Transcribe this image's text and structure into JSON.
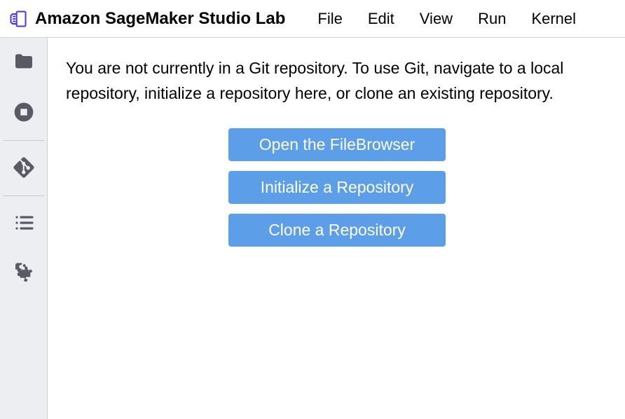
{
  "app": {
    "title": "Amazon SageMaker Studio Lab"
  },
  "menu": {
    "items": [
      {
        "label": "File"
      },
      {
        "label": "Edit"
      },
      {
        "label": "View"
      },
      {
        "label": "Run"
      },
      {
        "label": "Kernel"
      }
    ]
  },
  "sidebar": {
    "folder_icon": "folder",
    "running_icon": "stop-circle",
    "git_icon": "git",
    "contents_icon": "list",
    "extensions_icon": "puzzle"
  },
  "git_panel": {
    "message": "You are not currently in a Git repository. To use Git, navigate to a local repository, initialize a repository here, or clone an existing repository.",
    "buttons": {
      "open_filebrowser": "Open the FileBrowser",
      "init_repo": "Initialize a Repository",
      "clone_repo": "Clone a Repository"
    }
  }
}
